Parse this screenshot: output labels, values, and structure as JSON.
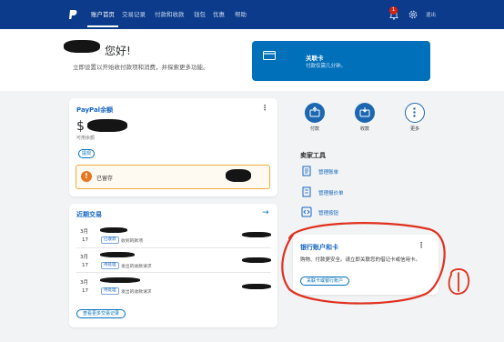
{
  "nav": {
    "items": [
      "账户首页",
      "交易记录",
      "付款和收款",
      "钱包",
      "优惠",
      "帮助"
    ],
    "notification_count": "1",
    "logout": "退出"
  },
  "welcome": {
    "greeting": "您好!",
    "subtitle": "立即设置以开始收付款项和消费，并探索更多功能。"
  },
  "link_card": {
    "title": "关联卡",
    "subtitle": "付款仅需几分钟。"
  },
  "balance": {
    "title": "PayPal余额",
    "currency_symbol": "$",
    "available_label": "可用余额",
    "withdraw_button": "提现",
    "reserve_label": "已留存",
    "menu": "⋮"
  },
  "recent": {
    "title": "近期交易",
    "arrow": "→",
    "transactions": [
      {
        "month": "3月",
        "day": "17",
        "tag": "已收款",
        "desc": "收到的款项"
      },
      {
        "month": "3月",
        "day": "17",
        "tag": "待处理",
        "desc": "发出的收款请求"
      },
      {
        "month": "3月",
        "day": "17",
        "tag": "待处理",
        "desc": "发出的收款请求"
      }
    ],
    "more_button": "查看更多交易记录"
  },
  "actions": [
    {
      "label": "付款",
      "icon": "send-money-icon"
    },
    {
      "label": "收款",
      "icon": "request-money-icon"
    },
    {
      "label": "更多",
      "icon": "more-icon"
    }
  ],
  "seller_tools": {
    "title": "卖家工具",
    "items": [
      {
        "label": "管理账单",
        "icon": "invoice-icon"
      },
      {
        "label": "管理报价单",
        "icon": "estimate-icon"
      },
      {
        "label": "管理按钮",
        "icon": "code-icon"
      }
    ]
  },
  "bank_card": {
    "title": "银行账户和卡",
    "text": "购物、付款更安全。请立即关联您的借记卡或信用卡。",
    "button": "关联卡或银行账户",
    "menu": "⋮"
  },
  "colors": {
    "nav_bg": "#0b3b8a",
    "accent": "#0070ba",
    "warning": "#e87722",
    "annotation": "#e0301e"
  }
}
